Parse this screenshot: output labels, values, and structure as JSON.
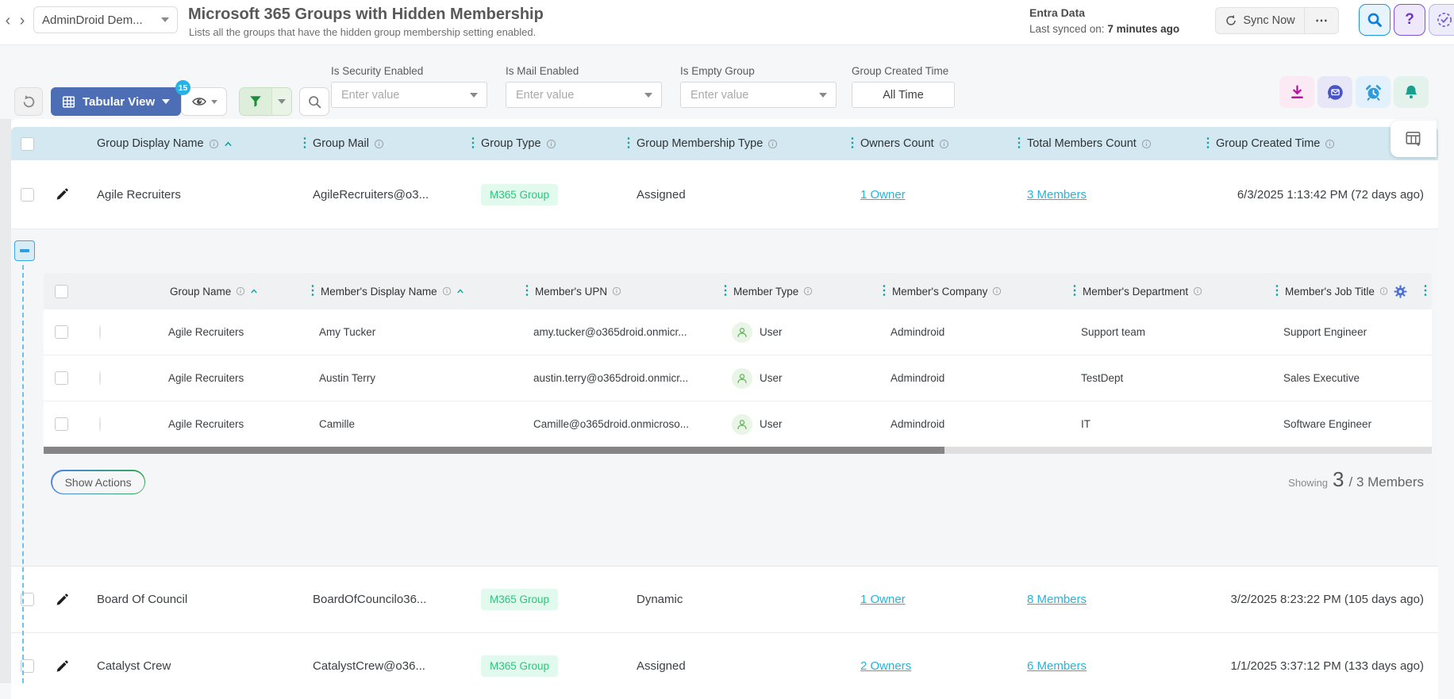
{
  "palette": {
    "accent_blue": "#4d6db5",
    "teal_accent": "#0fa3a0",
    "link_cyan": "#2ab3d6",
    "badge_green_text": "#27c87a",
    "badge_green_bg": "#e2f9ee",
    "header_row_bg": "#d4e8f1"
  },
  "topbar": {
    "nav_back": "‹",
    "nav_forward": "›",
    "tenant_selector": "AdminDroid Dem...",
    "title": "Microsoft 365 Groups with Hidden Membership",
    "subtitle": "Lists all the groups that have the hidden group membership setting enabled.",
    "data_source": "Entra Data",
    "last_synced_label": "Last synced on:",
    "last_synced_value": "7 minutes ago",
    "sync_button": "Sync Now",
    "more_button": "⋯",
    "help_label": "?"
  },
  "toolbar": {
    "view_button": "Tabular View",
    "eye_badge": "15",
    "filters": [
      {
        "label": "Is Security Enabled",
        "placeholder": "Enter value"
      },
      {
        "label": "Is Mail Enabled",
        "placeholder": "Enter value"
      },
      {
        "label": "Is Empty Group",
        "placeholder": "Enter value"
      }
    ],
    "created_filter": {
      "label": "Group Created Time",
      "value": "All Time"
    }
  },
  "table": {
    "columns": [
      "Group Display Name",
      "Group Mail",
      "Group Type",
      "Group Membership Type",
      "Owners Count",
      "Total Members Count",
      "Group Created Time"
    ],
    "rows": [
      {
        "name": "Agile Recruiters",
        "mail": "AgileRecruiters@o3...",
        "type": "M365 Group",
        "membership": "Assigned",
        "owners": "1 Owner",
        "members": "3 Members",
        "created": "6/3/2025 1:13:42 PM (72 days ago)"
      },
      {
        "name": "Board Of Council",
        "mail": "BoardOfCouncilo36...",
        "type": "M365 Group",
        "membership": "Dynamic",
        "owners": "1 Owner",
        "members": "8 Members",
        "created": "3/2/2025 8:23:22 PM (105 days ago)"
      },
      {
        "name": "Catalyst Crew",
        "mail": "CatalystCrew@o36...",
        "type": "M365 Group",
        "membership": "Assigned",
        "owners": "2 Owners",
        "members": "6 Members",
        "created": "1/1/2025 3:37:12 PM (133 days ago)"
      }
    ]
  },
  "subtable": {
    "columns": [
      "Group Name",
      "Member's Display Name",
      "Member's UPN",
      "Member Type",
      "Member's Company",
      "Member's Department",
      "Member's Job Title"
    ],
    "rows": [
      {
        "group": "Agile Recruiters",
        "display_name": "Amy Tucker",
        "upn": "amy.tucker@o365droid.onmicr...",
        "member_type": "User",
        "company": "Admindroid",
        "department": "Support team",
        "job_title": "Support Engineer"
      },
      {
        "group": "Agile Recruiters",
        "display_name": "Austin Terry",
        "upn": "austin.terry@o365droid.onmicr...",
        "member_type": "User",
        "company": "Admindroid",
        "department": "TestDept",
        "job_title": "Sales Executive"
      },
      {
        "group": "Agile Recruiters",
        "display_name": "Camille",
        "upn": "Camille@o365droid.onmicroso...",
        "member_type": "User",
        "company": "Admindroid",
        "department": "IT",
        "job_title": "Software Engineer"
      }
    ],
    "show_actions": "Show Actions",
    "showing_label": "Showing",
    "showing_count": "3",
    "showing_total": "/ 3 Members"
  }
}
